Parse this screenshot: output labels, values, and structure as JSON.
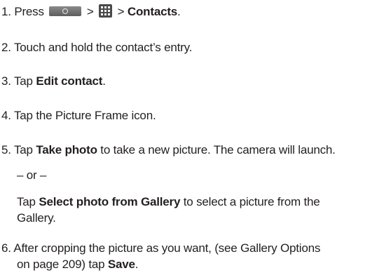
{
  "steps": [
    {
      "num": "1.",
      "press": "Press",
      "sep1": ">",
      "sep2": ">",
      "target": "Contacts",
      "end": ".",
      "icons": [
        "home-key-icon",
        "apps-grid-icon"
      ]
    },
    {
      "num": "2.",
      "text": "Touch and hold the contact’s entry."
    },
    {
      "num": "3.",
      "pre": "Tap",
      "bold": "Edit contact",
      "end": "."
    },
    {
      "num": "4.",
      "text": "Tap the Picture Frame icon."
    },
    {
      "num": "5.",
      "pre": "Tap",
      "bold": "Take photo",
      "post": "to take a new picture. The camera will launch.",
      "or": "– or –",
      "alt_pre": "Tap",
      "alt_bold": "Select photo from Gallery",
      "alt_post_1": "to select a picture from the",
      "alt_post_2": "Gallery."
    },
    {
      "num": "6.",
      "text_1": "After cropping the picture as you want, (see Gallery Options",
      "text_2": "on page 209) tap",
      "bold": "Save",
      "end": "."
    }
  ]
}
